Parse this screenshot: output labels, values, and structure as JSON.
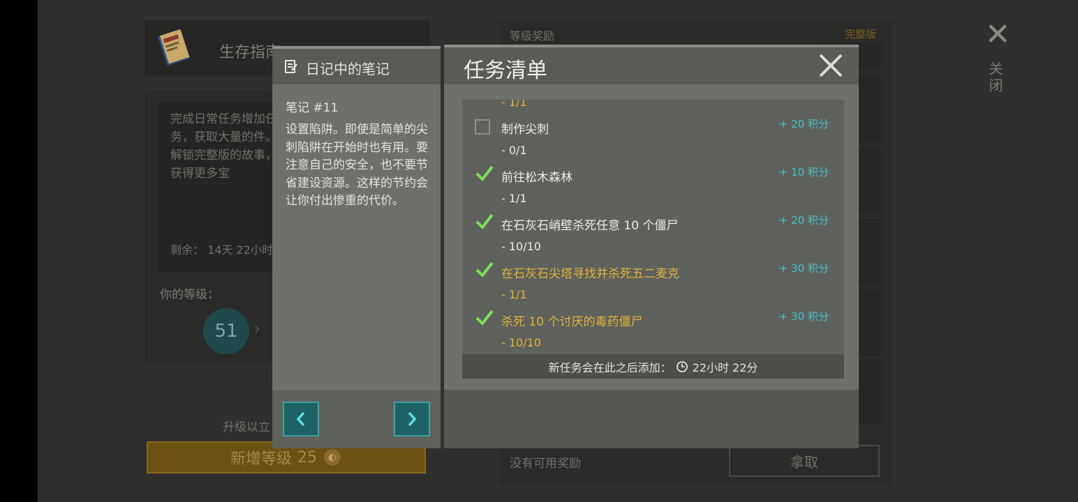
{
  "background": {
    "guide_title": "生存指南",
    "description": "完成日常任务增加任务，获取大量的件。解锁完整版的故事，获得更多宝",
    "remaining": "剩余：  14天 22小时",
    "level_label": "你的等级：",
    "level_value": "51",
    "upgrade_text": "升级以立",
    "add_level_label": "新增等级",
    "add_level_cost": "25",
    "rewards_label": "等级奖励",
    "full_version_label": "完整版",
    "no_reward_text": "没有可用奖励",
    "claim_label": "拿取",
    "close_label": "关闭"
  },
  "notes": {
    "title": "日记中的笔记",
    "note_number": "笔记 #11",
    "note_text": "设置陷阱。即使是简单的尖刺陷阱在开始时也有用。要注意自己的安全，也不要节省建设资源。这样的节约会让你付出惨重的代价。"
  },
  "tasks": {
    "title": "任务清单",
    "partial_top_progress": "- 1/1",
    "items": [
      {
        "title": "制作尖刺",
        "points": "+ 20  积分",
        "progress": "- 0/1",
        "done": false,
        "highlight": false
      },
      {
        "title": "前往松木森林",
        "points": "+ 10  积分",
        "progress": "- 1/1",
        "done": true,
        "highlight": false
      },
      {
        "title": "在石灰石峭壁杀死任意 10 个僵尸",
        "points": "+ 20  积分",
        "progress": "- 10/10",
        "done": true,
        "highlight": false
      },
      {
        "title": "在石灰石尖塔寻找并杀死五二麦克",
        "points": "+ 30  积分",
        "progress": "- 1/1",
        "done": true,
        "highlight": true
      },
      {
        "title": "杀死 10 个讨厌的毒药僵尸",
        "points": "+ 30  积分",
        "progress": "- 10/10",
        "done": true,
        "highlight": true
      }
    ],
    "footer_text": "新任务会在此之后添加：",
    "footer_time": "22小时 22分"
  },
  "colors": {
    "accent_teal": "#44c4c9",
    "check_green": "#7ee05a",
    "highlight_gold": "#e0b23a"
  }
}
